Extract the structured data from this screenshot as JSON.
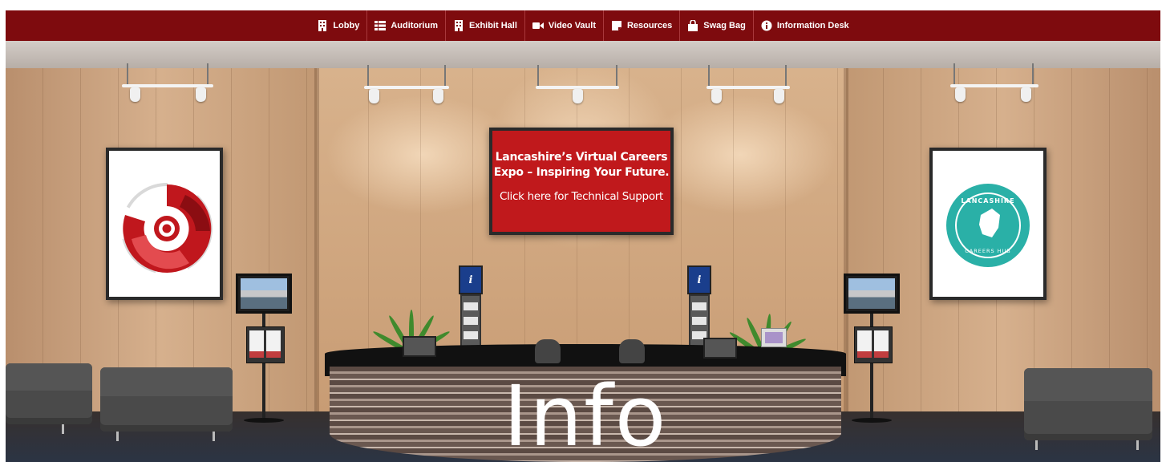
{
  "nav": {
    "items": [
      {
        "label": "Lobby",
        "icon": "building-icon"
      },
      {
        "label": "Auditorium",
        "icon": "list-icon"
      },
      {
        "label": "Exhibit Hall",
        "icon": "building-icon"
      },
      {
        "label": "Video Vault",
        "icon": "video-camera-icon"
      },
      {
        "label": "Resources",
        "icon": "sticky-note-icon"
      },
      {
        "label": "Swag Bag",
        "icon": "shopping-bag-icon"
      },
      {
        "label": "Information Desk",
        "icon": "info-circle-icon"
      }
    ],
    "background": "#7e0b0e",
    "text_color": "#ffffff"
  },
  "sign": {
    "headline_line1": "Lancashire’s Virtual Careers",
    "headline_line2": "Expo – Inspiring Your Future.",
    "support_link": "Click here for Technical Support",
    "color": "#c0191c"
  },
  "right_poster": {
    "top_text": "LANCASHIRE",
    "bottom_text": "CAREERS HUB",
    "color": "#2ab0a7"
  },
  "left_poster": {
    "color": "#c0171d"
  },
  "kiosk": {
    "icon_label": "i"
  },
  "desk": {
    "word": "Info"
  }
}
